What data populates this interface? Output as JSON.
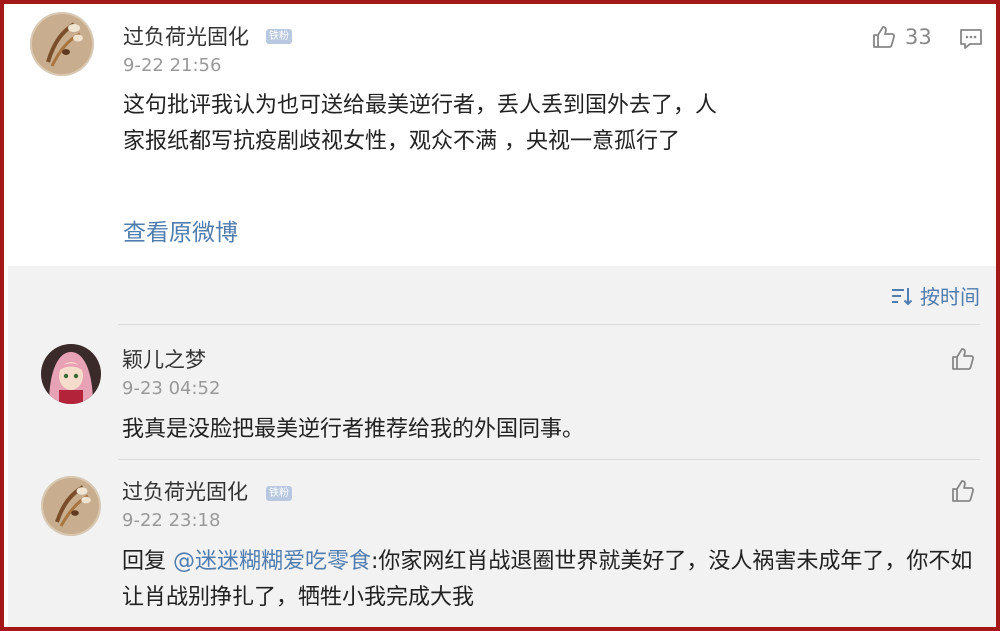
{
  "post": {
    "username": "过负荷光固化",
    "badge": "铁粉",
    "time": "9-22 21:56",
    "like_count": "33",
    "text": "这句批评我认为也可送给最美逆行者，丢人丢到国外去了，人家报纸都写抗疫剧歧视女性，观众不满 ，央视一意孤行了",
    "view_original": "查看原微博"
  },
  "sort": {
    "label": "按时间"
  },
  "replies": [
    {
      "username": "颖儿之梦",
      "time": "9-23 04:52",
      "text": "我真是没脸把最美逆行者推荐给我的外国同事。"
    },
    {
      "username": "过负荷光固化",
      "badge": "铁粉",
      "time": "9-22 23:18",
      "reply_prefix": "回复 ",
      "mention": "@迷迷糊糊爱吃零食",
      "text": ":你家网红肖战退圈世界就美好了，没人祸害未成年了，你不如让肖战别挣扎了，牺牲小我完成大我"
    }
  ],
  "colors": {
    "link": "#507daf",
    "border": "#a41818",
    "background_gray": "#f2f2f2"
  },
  "icons": {
    "like": "thumbs-up-icon",
    "comment": "comment-icon",
    "sort": "sort-icon"
  }
}
